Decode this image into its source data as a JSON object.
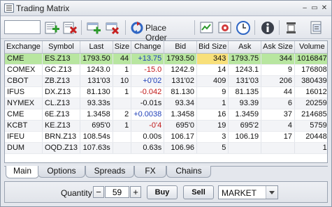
{
  "window": {
    "title": "Trading Matrix"
  },
  "titlebar_controls": {
    "minimize": "–",
    "maximize": "▭",
    "close": "✕"
  },
  "toolbar": {
    "symbol_value": "",
    "place_order_label": "Place Order",
    "icons": [
      "add-symbol-icon",
      "remove-symbol-icon",
      "add-row-icon",
      "delete-row-icon",
      "place-order-icon",
      "chart-icon",
      "settings-icon",
      "clock-icon",
      "info-icon",
      "columns-icon",
      "export-icon"
    ]
  },
  "grid": {
    "columns": [
      "Exchange",
      "Symbol",
      "Last",
      "Size",
      "Change",
      "Bid",
      "Bid Size",
      "Ask",
      "Ask Size",
      "Volume"
    ],
    "rows": [
      {
        "exchange": "CME",
        "symbol": "ES.Z13",
        "last": "1793.50",
        "size": "44",
        "change": "+13.75",
        "change_dir": "pos",
        "bid": "1793.50",
        "bid_size": "343",
        "ask": "1793.75",
        "ask_size": "344",
        "volume": "1016847"
      },
      {
        "exchange": "COMEX",
        "symbol": "GC.Z13",
        "last": "1243.0",
        "size": "1",
        "change": "-15.0",
        "change_dir": "neg",
        "bid": "1242.9",
        "bid_size": "14",
        "ask": "1243.1",
        "ask_size": "9",
        "volume": "176808"
      },
      {
        "exchange": "CBOT",
        "symbol": "ZB.Z13",
        "last": "131'03",
        "size": "10",
        "change": "+0'02",
        "change_dir": "pos",
        "bid": "131'02",
        "bid_size": "409",
        "ask": "131'03",
        "ask_size": "206",
        "volume": "380439"
      },
      {
        "exchange": "IFUS",
        "symbol": "DX.Z13",
        "last": "81.130",
        "size": "1",
        "change": "-0.042",
        "change_dir": "neg",
        "bid": "81.130",
        "bid_size": "9",
        "ask": "81.135",
        "ask_size": "44",
        "volume": "16012"
      },
      {
        "exchange": "NYMEX",
        "symbol": "CL.Z13",
        "last": "93.33s",
        "size": "",
        "change": "-0.01s",
        "change_dir": "none",
        "bid": "93.34",
        "bid_size": "1",
        "ask": "93.39",
        "ask_size": "6",
        "volume": "20259"
      },
      {
        "exchange": "CME",
        "symbol": "6E.Z13",
        "last": "1.3458",
        "size": "2",
        "change": "+0.0038",
        "change_dir": "pos",
        "bid": "1.3458",
        "bid_size": "16",
        "ask": "1.3459",
        "ask_size": "37",
        "volume": "214685"
      },
      {
        "exchange": "KCBT",
        "symbol": "KE.Z13",
        "last": "695'0",
        "size": "1",
        "change": "-0'4",
        "change_dir": "neg",
        "bid": "695'0",
        "bid_size": "19",
        "ask": "695'2",
        "ask_size": "4",
        "volume": "5759"
      },
      {
        "exchange": "IFEU",
        "symbol": "BRN.Z13",
        "last": "108.54s",
        "size": "",
        "change": "0.00s",
        "change_dir": "none",
        "bid": "106.17",
        "bid_size": "3",
        "ask": "106.19",
        "ask_size": "17",
        "volume": "20448"
      },
      {
        "exchange": "DUM",
        "symbol": "OQD.Z13",
        "last": "107.63s",
        "size": "",
        "change": "0.63s",
        "change_dir": "none",
        "bid": "106.96",
        "bid_size": "5",
        "ask": "",
        "ask_size": "",
        "volume": "1"
      }
    ]
  },
  "tabs": [
    "Main",
    "Options",
    "Spreads",
    "FX",
    "Chains"
  ],
  "order_bar": {
    "quantity_label": "Quantity",
    "quantity_value": "59",
    "minus": "−",
    "plus": "+",
    "buy_label": "Buy",
    "sell_label": "Sell",
    "order_type": "MARKET"
  },
  "colors": {
    "selected_row": "#b8e6a0",
    "bid_size_highlight": "#f8e07a",
    "positive": "#1f3fb8",
    "negative": "#c01818"
  }
}
